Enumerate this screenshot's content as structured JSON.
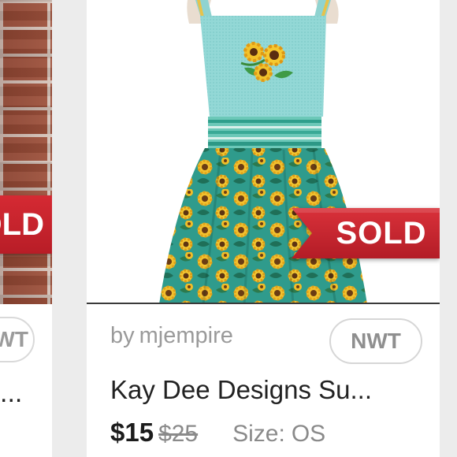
{
  "left_card": {
    "sold_label": "SOLD",
    "badge_label": "NWT",
    "title_fragment": "..."
  },
  "listing": {
    "image_icon": "apron-product-photo",
    "sold_label": "SOLD",
    "seller_prefix": "by",
    "seller_name": "mjempire",
    "condition_badge": "NWT",
    "title": "Kay Dee Designs Su...",
    "price": "$15",
    "original_price": "$25",
    "size_label": "Size:",
    "size_value": "OS"
  },
  "colors": {
    "sold_red": "#c9232d",
    "apron_aqua": "#8fd6d4",
    "apron_teal": "#2e9a8a",
    "sunflower_yellow": "#f0c020",
    "text_dark": "#222222",
    "text_gray": "#8a8a8a"
  }
}
